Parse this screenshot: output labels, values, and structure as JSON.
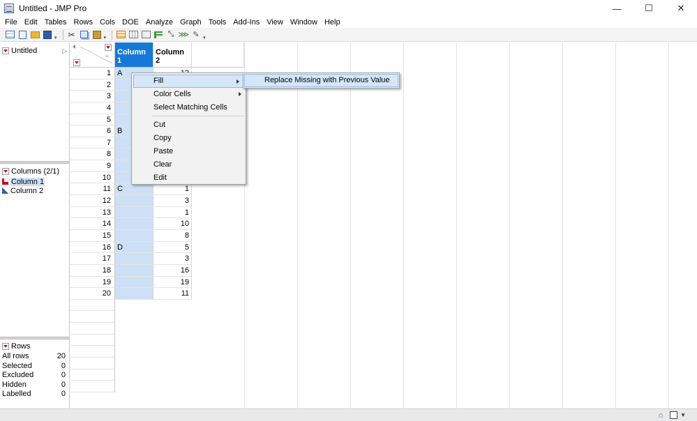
{
  "window": {
    "title": "Untitled - JMP Pro",
    "controls": {
      "minimize": "—",
      "maximize": "☐",
      "close": "✕"
    }
  },
  "menubar": [
    "File",
    "Edit",
    "Tables",
    "Rows",
    "Cols",
    "DOE",
    "Analyze",
    "Graph",
    "Tools",
    "Add-Ins",
    "View",
    "Window",
    "Help"
  ],
  "toolbar": {
    "icons": [
      "new-data-table-icon",
      "new-script-icon",
      "open-icon",
      "save-icon",
      "cut-icon",
      "copy-icon",
      "paste-icon",
      "data-table-icon",
      "tabulate-icon",
      "distribution-icon",
      "fit-y-by-x-icon",
      "fit-model-icon",
      "graph-builder-icon",
      "script-editor-icon"
    ]
  },
  "table_panel": {
    "title": "Untitled"
  },
  "columns_panel": {
    "title": "Columns (2/1)",
    "items": [
      {
        "label": "Column 1",
        "type": "nominal"
      },
      {
        "label": "Column 2",
        "type": "continuous"
      }
    ]
  },
  "rows_panel": {
    "title": "Rows",
    "stats": [
      {
        "label": "All rows",
        "value": "20"
      },
      {
        "label": "Selected",
        "value": "0"
      },
      {
        "label": "Excluded",
        "value": "0"
      },
      {
        "label": "Hidden",
        "value": "0"
      },
      {
        "label": "Labelled",
        "value": "0"
      }
    ]
  },
  "grid": {
    "columns": [
      "Column 1",
      "Column 2"
    ],
    "row_numbers": [
      "1",
      "2",
      "3",
      "4",
      "5",
      "6",
      "7",
      "8",
      "9",
      "10",
      "11",
      "12",
      "13",
      "14",
      "15",
      "16",
      "17",
      "18",
      "19",
      "20"
    ],
    "col1": [
      "A",
      "",
      "",
      "",
      "",
      "B",
      "",
      "",
      "",
      "",
      "C",
      "",
      "",
      "",
      "",
      "D",
      "",
      "",
      "",
      ""
    ],
    "col2": [
      "12",
      "",
      "",
      "",
      "",
      "",
      "",
      "",
      "",
      "",
      "1",
      "3",
      "1",
      "10",
      "8",
      "5",
      "3",
      "16",
      "19",
      "11"
    ]
  },
  "context_menu": {
    "items": [
      "Fill",
      "Color Cells",
      "Select Matching Cells",
      "Cut",
      "Copy",
      "Paste",
      "Clear",
      "Edit"
    ],
    "submenu_item": "Replace Missing with Previous Value"
  }
}
